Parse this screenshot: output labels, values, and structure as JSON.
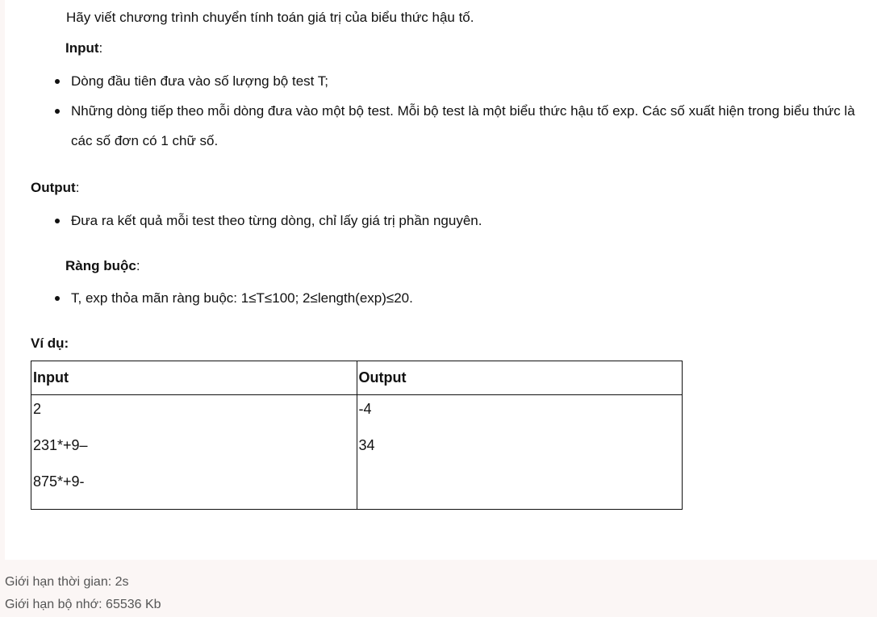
{
  "problem": {
    "intro": "Hãy viết chương trình chuyển tính toán giá trị của biểu thức hậu tố.",
    "input_label": "Input",
    "input_items": [
      "Dòng đầu tiên đưa vào số lượng bộ test T;",
      "Những dòng tiếp theo mỗi dòng đưa vào một bộ test. Mỗi bộ test là một biểu thức hậu tố exp. Các số xuất hiện trong biểu thức là các số đơn có 1 chữ số."
    ],
    "output_label": "Output",
    "output_items": [
      "Đưa ra kết quả mỗi test theo từng dòng, chỉ lấy giá trị phần nguyên."
    ],
    "constraints_label": "Ràng buộc",
    "constraints_items": [
      "T, exp thỏa mãn ràng buộc: 1≤T≤100; 2≤length(exp)≤20."
    ],
    "example_label": "Ví dụ:",
    "colon": ":"
  },
  "example_table": {
    "headers": [
      "Input",
      "Output"
    ],
    "input_lines": [
      "2",
      "231*+9–",
      "875*+9-"
    ],
    "output_lines": [
      "-4",
      "34"
    ]
  },
  "limits": {
    "time": "Giới hạn thời gian: 2s",
    "memory": "Giới hạn bộ nhớ: 65536 Kb"
  }
}
